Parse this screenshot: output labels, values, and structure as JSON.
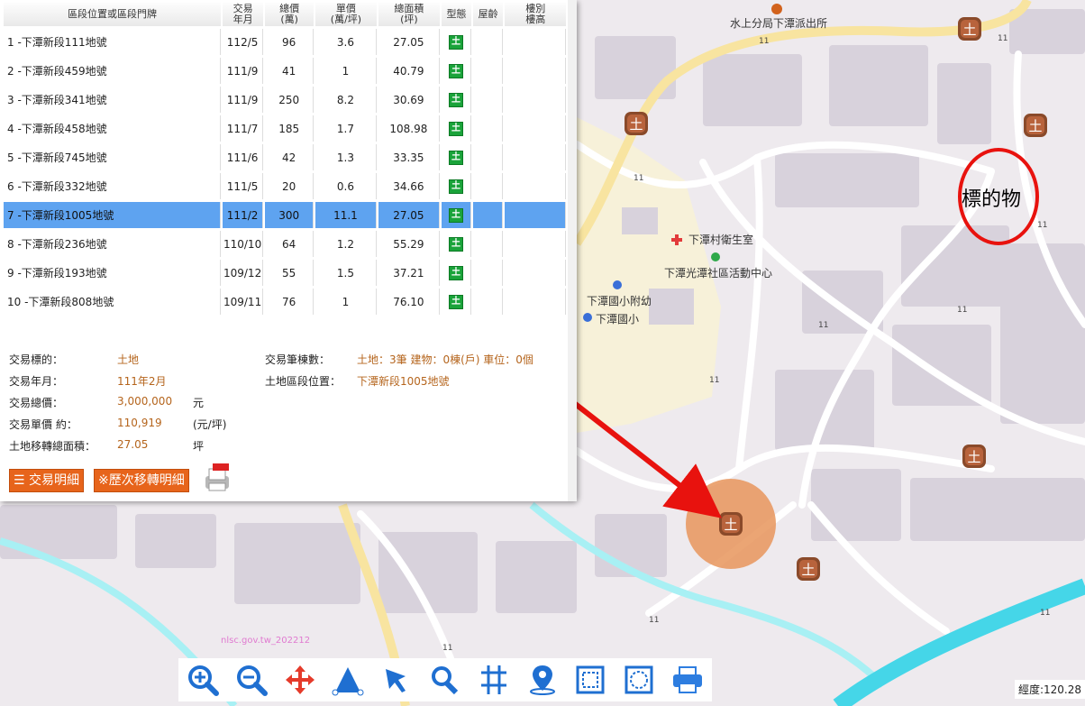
{
  "table": {
    "headers": [
      "區段位置或區段門牌",
      "交易\n年月",
      "總價\n(萬)",
      "單價\n(萬/坪)",
      "總面積\n(坪)",
      "型態",
      "屋齡",
      "樓別\n樓高"
    ],
    "rows": [
      {
        "name": "1 -下潭新段111地號",
        "date": "112/5",
        "total": "96",
        "unit": "3.6",
        "area": "27.05"
      },
      {
        "name": "2 -下潭新段459地號",
        "date": "111/9",
        "total": "41",
        "unit": "1",
        "area": "40.79"
      },
      {
        "name": "3 -下潭新段341地號",
        "date": "111/9",
        "total": "250",
        "unit": "8.2",
        "area": "30.69"
      },
      {
        "name": "4 -下潭新段458地號",
        "date": "111/7",
        "total": "185",
        "unit": "1.7",
        "area": "108.98"
      },
      {
        "name": "5 -下潭新段745地號",
        "date": "111/6",
        "total": "42",
        "unit": "1.3",
        "area": "33.35"
      },
      {
        "name": "6 -下潭新段332地號",
        "date": "111/5",
        "total": "20",
        "unit": "0.6",
        "area": "34.66"
      },
      {
        "name": "7 -下潭新段1005地號",
        "date": "111/2",
        "total": "300",
        "unit": "11.1",
        "area": "27.05"
      },
      {
        "name": "8 -下潭新段236地號",
        "date": "110/10",
        "total": "64",
        "unit": "1.2",
        "area": "55.29"
      },
      {
        "name": "9 -下潭新段193地號",
        "date": "109/12",
        "total": "55",
        "unit": "1.5",
        "area": "37.21"
      },
      {
        "name": "10 -下潭新段808地號",
        "date": "109/11",
        "total": "76",
        "unit": "1",
        "area": "76.10"
      }
    ],
    "selected_index": 6,
    "type_icon": "土"
  },
  "details": {
    "target_label": "交易標的：",
    "target_value": "土地",
    "date_label": "交易年月：",
    "date_value": "111年2月",
    "total_label": "交易總價：",
    "total_value": "3,000,000",
    "total_unit": "元",
    "unit_label": "交易單價 約：",
    "unit_value": "110,919",
    "unit_unit": "(元/坪)",
    "area_label": "土地移轉總面積：",
    "area_value": "27.05",
    "area_unit": "坪",
    "count_label": "交易筆棟數：",
    "count_value": "土地：3筆 建物：0棟(戶) 車位：0個",
    "location_label": "土地區段位置：",
    "location_value": "下潭新段1005地號"
  },
  "buttons": {
    "detail": "交易明細",
    "history": "※歷次移轉明細"
  },
  "map": {
    "labels": {
      "police": "水上分局下潭派出所",
      "clinic": "下潭村衛生室",
      "community": "下潭光潭社區活動中心",
      "kindergarten": "下潭國小附幼",
      "school": "下潭國小",
      "target": "標的物",
      "watermark": "nlsc.gov.tw_202212"
    },
    "road_mark": "11",
    "marker_glyph": "土"
  },
  "coord_label": "經度:120.28",
  "colors": {
    "selected": "#5ea3f0",
    "accent": "#e7641b",
    "value": "#b5651d",
    "arrow": "#e8120e"
  }
}
